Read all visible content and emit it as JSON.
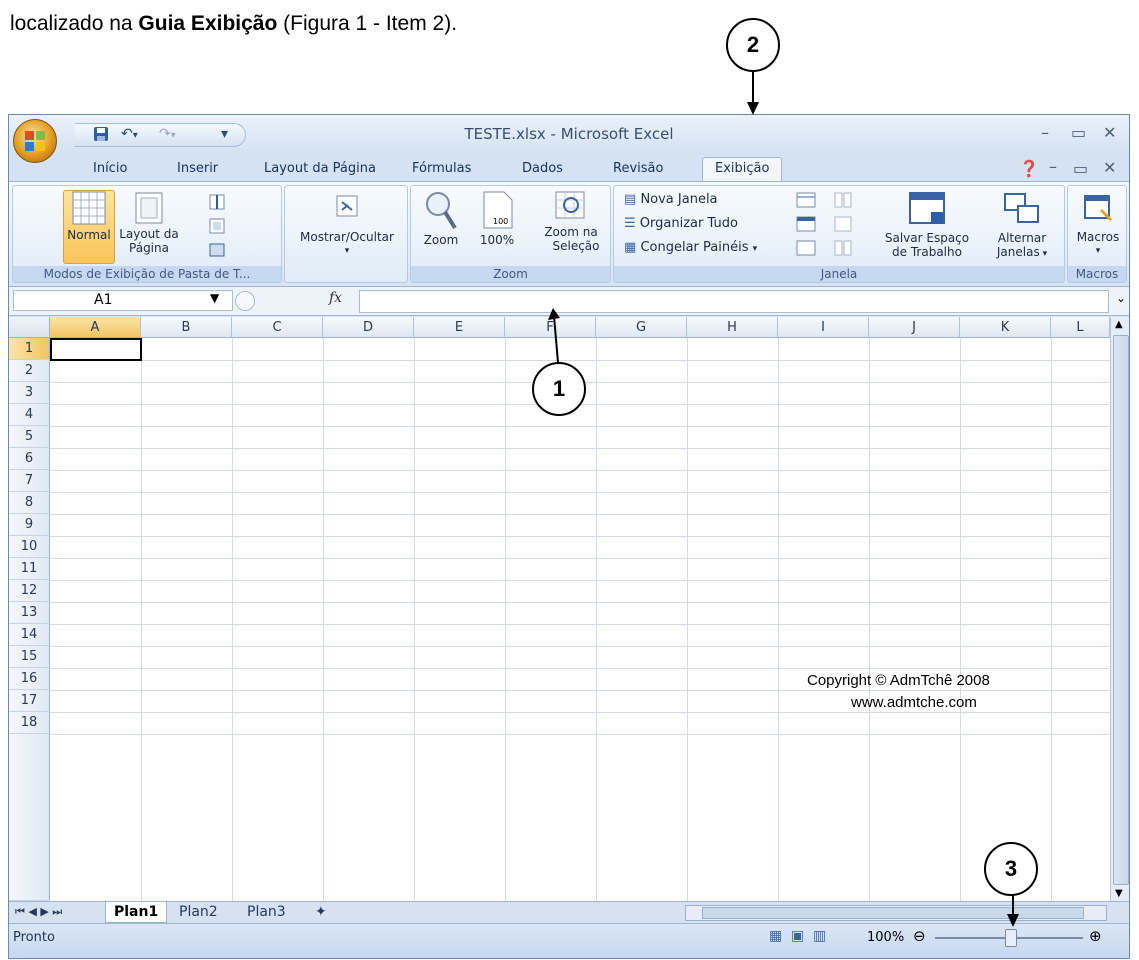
{
  "doc": {
    "text_before": "localizado na ",
    "text_bold": "Guia Exibição",
    "text_after": " (Figura 1 - Item 2)."
  },
  "callouts": {
    "c1": "1",
    "c2": "2",
    "c3": "3"
  },
  "window": {
    "title": "TESTE.xlsx - Microsoft Excel",
    "qat_separator": "▾"
  },
  "tabs": [
    {
      "label": "Início"
    },
    {
      "label": "Inserir"
    },
    {
      "label": "Layout da Página"
    },
    {
      "label": "Fórmulas"
    },
    {
      "label": "Dados"
    },
    {
      "label": "Revisão"
    },
    {
      "label": "Exibição"
    }
  ],
  "ribbon": {
    "modes": {
      "label": "Modos de Exibição de Pasta de T...",
      "normal": "Normal",
      "layout_line1": "Layout da",
      "layout_line2": "Página"
    },
    "show": {
      "label": "Mostrar/Ocultar"
    },
    "zoom": {
      "label": "Zoom",
      "zoom_btn": "Zoom",
      "pct_btn": "100%",
      "sel_line1": "Zoom na",
      "sel_line2": "Seleção",
      "page_icon_text": "100"
    },
    "window": {
      "label": "Janela",
      "new_window": "Nova Janela",
      "arrange_all": "Organizar Tudo",
      "freeze_panes": "Congelar Painéis",
      "save_ws_line1": "Salvar Espaço",
      "save_ws_line2": "de Trabalho",
      "switch_line1": "Alternar",
      "switch_line2": "Janelas"
    },
    "macros": {
      "label": "Macros",
      "btn": "Macros"
    }
  },
  "formula_bar": {
    "name_box": "A1",
    "fx": "fx"
  },
  "grid": {
    "columns": [
      "A",
      "B",
      "C",
      "D",
      "E",
      "F",
      "G",
      "H",
      "I",
      "J",
      "K",
      "L"
    ],
    "rows": [
      "1",
      "2",
      "3",
      "4",
      "5",
      "6",
      "7",
      "8",
      "9",
      "10",
      "11",
      "12",
      "13",
      "14",
      "15",
      "16",
      "17",
      "18"
    ],
    "cell_j16": "Copyright © AdmTchê 2008",
    "cell_j17": "www.admtche.com"
  },
  "sheets": [
    "Plan1",
    "Plan2",
    "Plan3"
  ],
  "status": {
    "text": "Pronto",
    "zoom": "100%"
  },
  "colors": {
    "accent": "#f8c45a",
    "ribbon": "#dbe7f5",
    "frame": "#6a8ab6"
  }
}
